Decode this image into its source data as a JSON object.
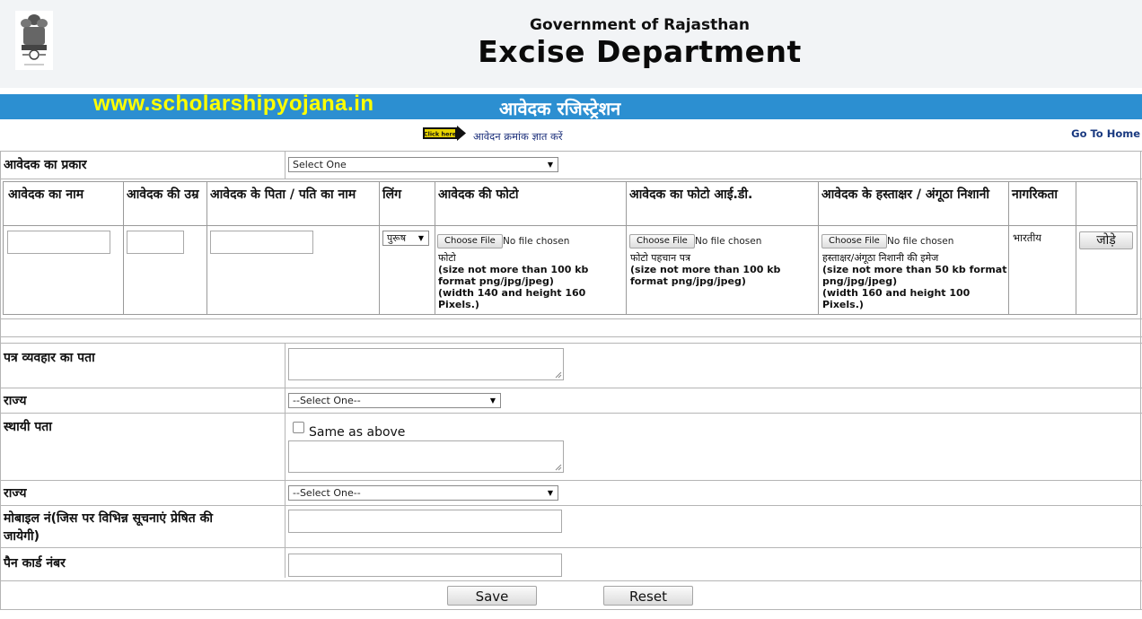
{
  "header": {
    "gov_title": "Government of Rajasthan",
    "dept_title": "Excise Department",
    "emblem_caption": "सत्यमेव जयते"
  },
  "banner": {
    "watermark": "www.scholarshipyojana.in",
    "title": "आवेदक रजिस्ट्रेशन"
  },
  "nav": {
    "click_badge": "Click here",
    "query_link": "आवेदन क्रमांक ज्ञात करें",
    "home_link": "Go To Home"
  },
  "form": {
    "applicant_type_label": "आवेदक का प्रकार",
    "applicant_type_value": "Select One",
    "columns": {
      "name": "आवेदक का नाम",
      "age": "आवेदक की उम्र",
      "father_husband": "आवेदक के पिता / पति का नाम",
      "gender": "लिंग",
      "photo": "आवेदक की फोटो",
      "photo_id": "आवेदक का फोटो आई.डी.",
      "signature": "आवेदक के हस्ताक्षर / अंगूठा निशानी",
      "citizenship": "नागरिकता"
    },
    "gender_value": "पुरूष",
    "choose_file_label": "Choose File",
    "no_file_label": "No file chosen",
    "photo_hint": {
      "title": "फोटो",
      "line1": "(size not more than 100 kb",
      "line2": "format png/jpg/jpeg)",
      "line3": "(width 140 and height 160",
      "line4": "Pixels.)"
    },
    "photo_id_hint": {
      "title": "फोटो पहचान पत्र",
      "line1": "(size not more than 100 kb",
      "line2": "format png/jpg/jpeg)"
    },
    "signature_hint": {
      "title": "हस्ताक्षर/अंगूठा निशानी की इमेज",
      "line1": "(size not more than 50 kb format",
      "line2": "png/jpg/jpeg)",
      "line3": "(width 160 and height 100",
      "line4": "Pixels.)"
    },
    "citizenship_value": "भारतीय",
    "add_button": "जोड़े",
    "address_label": "पत्र व्यवहार का पता",
    "state_label": "राज्य",
    "state_value": "--Select One--",
    "permanent_address_label": "स्थायी पता",
    "same_as_above": "Same as above",
    "state2_label": "राज्य",
    "state2_value": "--Select One--",
    "mobile_label_1": "मोबाइल नं(जिस पर विभिन्न सूचनाएं प्रेषित की",
    "mobile_label_2": "जायेगी)",
    "pan_label": "पैन कार्ड नंबर",
    "save_button": "Save",
    "reset_button": "Reset"
  }
}
